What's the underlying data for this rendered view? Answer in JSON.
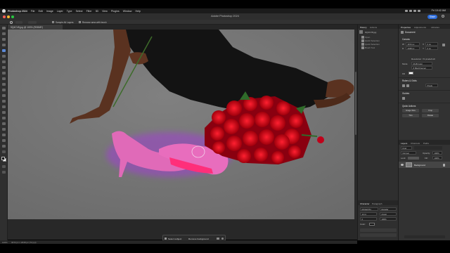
{
  "menubar": {
    "app": "Photoshop 2024",
    "items": [
      "File",
      "Edit",
      "Image",
      "Layer",
      "Type",
      "Select",
      "Filter",
      "3D",
      "View",
      "Plugins",
      "Window",
      "Help"
    ],
    "clock": "Fri 10:42 AM"
  },
  "window": {
    "title": "Adobe Photoshop 2024",
    "share_label": "Share"
  },
  "options_bar": {
    "sample_all_layers": "Sample All Layers",
    "enhance_edge": "Remove area with brush"
  },
  "document": {
    "tab_label": "9Q4CV8.jpg @ 100% (RGB/8*)"
  },
  "context_bar": {
    "select_subject": "Select subject",
    "remove_background": "Remove background"
  },
  "status_bar": {
    "zoom": "100%",
    "info": "3072 px x 2048 px (72 ppi)"
  },
  "history_panel": {
    "tabs": [
      "History",
      "Actions"
    ],
    "items": [
      "9Q4CV8.jpg",
      "Open",
      "Quick Selection",
      "Quick Selection",
      "Brush Tool"
    ]
  },
  "channels_panel": {
    "tabs": [
      "Character",
      "Paragraph"
    ],
    "font": "Myriad Pro",
    "style": "Regular",
    "size": "12 pt",
    "leading": "(Auto)",
    "tracking": "0",
    "scale": "100%",
    "color_label": "Color:"
  },
  "properties_panel": {
    "tabs": [
      "Properties",
      "Adjustments",
      "Libraries"
    ],
    "doc_label": "Document",
    "canvas_header": "Canvas",
    "width": "3072 px",
    "height": "2048 px",
    "x": "0 px",
    "y": "0 px",
    "resolution_label": "Resolution: 72 pixels/inch",
    "mode_label": "Mode",
    "mode_value": "RGB Color",
    "depth_value": "8 Bits/Channel",
    "fill_label": "Fill",
    "rulers_header": "Rulers & Grids",
    "pixels_unit": "Pixels",
    "guides_header": "Guides",
    "quick_actions_header": "Quick Actions",
    "image_size_button": "Image Size",
    "trim_button": "Trim",
    "crop_button": "Crop",
    "rotate_button": "Rotate"
  },
  "layers_panel": {
    "tabs": [
      "Layers",
      "Channels",
      "Paths"
    ],
    "kind_label": "Kind",
    "blend_mode": "Normal",
    "opacity_label": "Opacity:",
    "opacity_value": "100%",
    "lock_label": "Lock:",
    "fill_label": "Fill:",
    "fill_value": "100%",
    "layer_name": "Background"
  },
  "colors": {
    "accent": "#2d6ddc",
    "canvas_bg": "#727272",
    "panel": "#323232"
  }
}
